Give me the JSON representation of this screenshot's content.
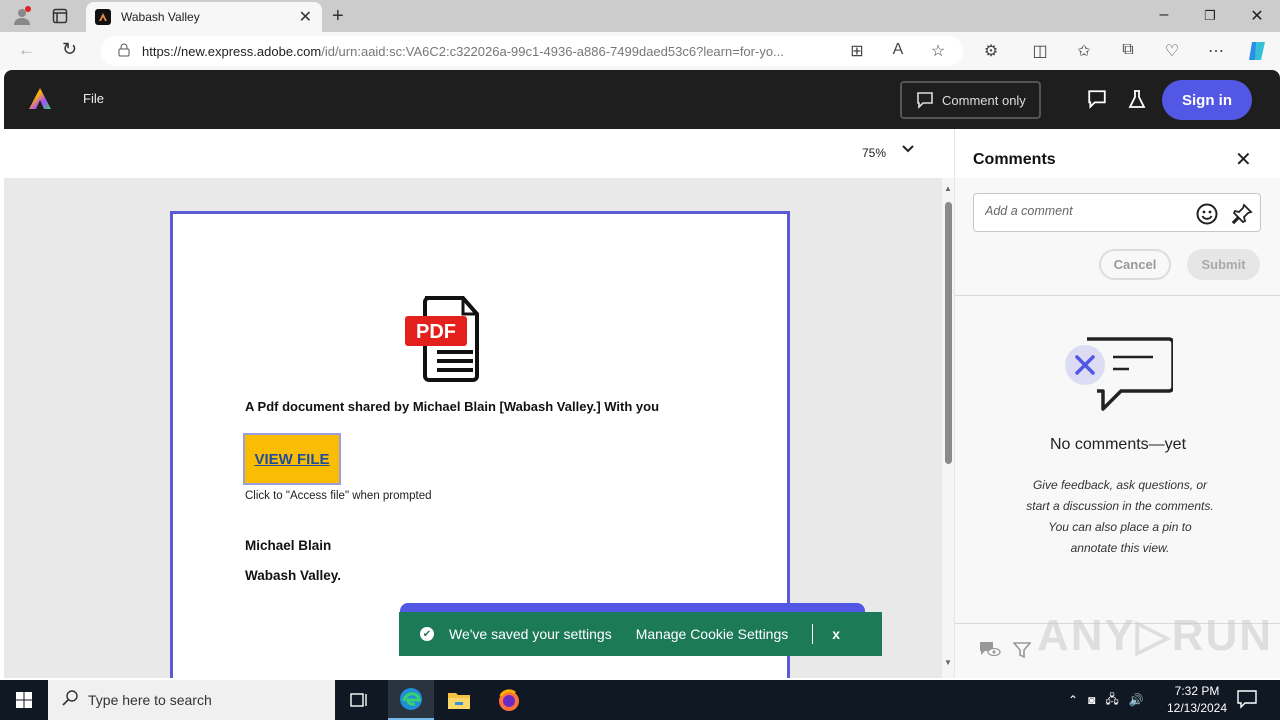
{
  "browser": {
    "tab_title": "Wabash Valley",
    "url_domain": "https://new.express.adobe.com",
    "url_path": "/id/urn:aaid:sc:VA6C2:c322026a-99c1-4936-a886-7499daed53c6?learn=for-yo..."
  },
  "app_header": {
    "file_menu": "File",
    "comment_only": "Comment only",
    "sign_in": "Sign in"
  },
  "viewer": {
    "zoom_level": "75%"
  },
  "document": {
    "pdf_badge": "PDF",
    "shared_text": "A Pdf document shared by Michael Blain [Wabash Valley.] With you",
    "view_file_button": "VIEW FILE",
    "click_note": "Click to \"Access file\" when prompted",
    "signature_name": "Michael Blain",
    "signature_org": "Wabash Valley."
  },
  "cookie_banner": {
    "saved_text": "We've saved your settings",
    "manage_link": "Manage Cookie Settings",
    "close": "x"
  },
  "comments": {
    "title": "Comments",
    "input_placeholder": "Add a comment",
    "cancel": "Cancel",
    "submit": "Submit",
    "empty_title": "No comments—yet",
    "empty_desc": "Give feedback, ask questions, or start a discussion in the comments. You can also place a pin to annotate this view."
  },
  "watermark": "ANY▷RUN",
  "taskbar": {
    "search_placeholder": "Type here to search",
    "time": "7:32 PM",
    "date": "12/13/2024"
  },
  "colors": {
    "accent": "#5258e4",
    "view_file_bg": "#fbbc04",
    "cookie_banner_bg": "#1c7a58",
    "app_header_bg": "#1e1e1e"
  }
}
